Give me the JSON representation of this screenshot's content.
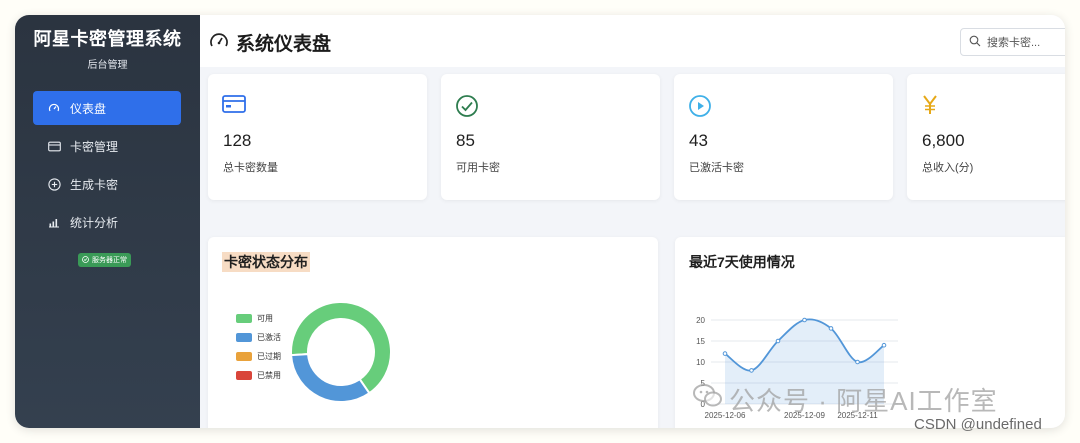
{
  "app": {
    "name": "阿星卡密管理系统",
    "subtitle": "后台管理"
  },
  "nav": [
    {
      "label": "仪表盘",
      "icon": "dashboard-icon",
      "active": true
    },
    {
      "label": "卡密管理",
      "icon": "card-icon",
      "active": false
    },
    {
      "label": "生成卡密",
      "icon": "plus-circle-icon",
      "active": false
    },
    {
      "label": "统计分析",
      "icon": "bar-chart-icon",
      "active": false
    }
  ],
  "server_status": "服务器正常",
  "header": {
    "title": "系统仪表盘",
    "search_placeholder": "搜索卡密..."
  },
  "stats": [
    {
      "value": "128",
      "label": "总卡密数量",
      "icon": "credit-card-icon",
      "color": "#2f6fea"
    },
    {
      "value": "85",
      "label": "可用卡密",
      "icon": "check-circle-icon",
      "color": "#2e7d4f"
    },
    {
      "value": "43",
      "label": "已激活卡密",
      "icon": "play-circle-icon",
      "color": "#3fb0e8"
    },
    {
      "value": "6,800",
      "label": "总收入(分)",
      "icon": "yen-icon",
      "color": "#e6a817"
    }
  ],
  "panels": {
    "status_title": "卡密状态分布",
    "usage_title": "最近7天使用情况"
  },
  "chart_data": [
    {
      "type": "pie",
      "title": "卡密状态分布",
      "categories": [
        "可用",
        "已激活",
        "已过期",
        "已禁用"
      ],
      "values": [
        85,
        43,
        0,
        0
      ],
      "colors": [
        "#67cd7b",
        "#5296d8",
        "#e9a23b",
        "#d9453a"
      ],
      "legend": "left"
    },
    {
      "type": "area",
      "title": "最近7天使用情况",
      "x": [
        "2025-12-06",
        "2025-12-07",
        "2025-12-08",
        "2025-12-09",
        "2025-12-10",
        "2025-12-11",
        "2025-12-12"
      ],
      "tick_labels": [
        "2025-12-06",
        "2025-12-09",
        "2025-12-11"
      ],
      "series": [
        {
          "values": [
            12,
            8,
            15,
            20,
            18,
            10,
            14
          ],
          "color": "#5296d8"
        }
      ],
      "ylim": [
        0,
        20
      ],
      "yticks": [
        0,
        5,
        10,
        15,
        20
      ],
      "grid": true
    }
  ],
  "watermark": {
    "text": "公众号 · 阿星AI工作室",
    "icon": "wechat-icon"
  },
  "credit": "CSDN @undefined"
}
